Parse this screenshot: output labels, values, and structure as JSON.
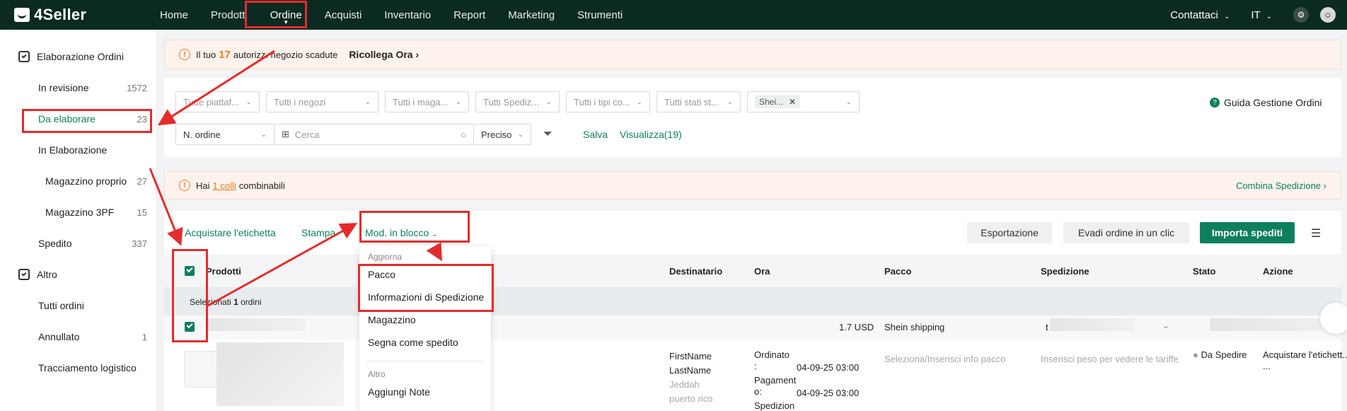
{
  "app": {
    "logo_text": "4Seller"
  },
  "nav": {
    "items": [
      {
        "label": "Home"
      },
      {
        "label": "Prodotti"
      },
      {
        "label": "Ordine"
      },
      {
        "label": "Acquisti"
      },
      {
        "label": "Inventario"
      },
      {
        "label": "Report"
      },
      {
        "label": "Marketing"
      },
      {
        "label": "Strumenti"
      }
    ],
    "contact": "Contattaci",
    "language": "IT"
  },
  "sidebar": {
    "section1": "Elaborazione Ordini",
    "items": [
      {
        "label": "In revisione",
        "count": "1572"
      },
      {
        "label": "Da elaborare",
        "count": "23"
      },
      {
        "label": "In Elaborazione",
        "count": ""
      },
      {
        "label": "Magazzino proprio",
        "count": "27"
      },
      {
        "label": "Magazzino 3PF",
        "count": "15"
      },
      {
        "label": "Spedito",
        "count": "337"
      }
    ],
    "section2": "Altro",
    "items2": [
      {
        "label": "Tutti ordini",
        "count": ""
      },
      {
        "label": "Annullato",
        "count": "1"
      },
      {
        "label": "Tracciamento logistico",
        "count": ""
      }
    ]
  },
  "alert1": {
    "prefix": "Il tuo",
    "number": "17",
    "suffix": "autorizz. negozio scadute",
    "action": "Ricollega Ora"
  },
  "filters": {
    "platform": "Tutte piattaf...",
    "shops": "Tutti i negozi",
    "warehouses": "Tutti i maga...",
    "shipping": "Tutti Spediz...",
    "types": "Tutti i tipi co...",
    "states": "Tutti stati st...",
    "tag": "Shei...",
    "guide": "Guida Gestione Ordini",
    "order_field": "N. ordine",
    "search_placeholder": "Cerca",
    "match": "Preciso",
    "save": "Salva",
    "view": "Visualizza(19)"
  },
  "alert2": {
    "prefix": "Hai",
    "link": "1 colli",
    "suffix": "combinabili",
    "action": "Combina Spedizione"
  },
  "toolbar": {
    "buy_label": "Acquistare l'etichetta",
    "print": "Stampa",
    "bulk_edit": "Mod. in blocco",
    "export": "Esportazione",
    "one_click": "Evadi ordine in un clic",
    "import_shipped": "Importa spediti"
  },
  "table": {
    "headers": {
      "products": "Prodotti",
      "recipient": "Destinatario",
      "time": "Ora",
      "package": "Pacco",
      "shipping": "Spedizione",
      "status": "Stato",
      "action": "Azione"
    },
    "selected_prefix": "Selezionati",
    "selected_count": "1",
    "selected_suffix": "ordini",
    "row": {
      "amount": "1.7 USD",
      "carrier": "Shein shipping",
      "ship_prefix": "t",
      "recipient_first": "FirstName",
      "recipient_last": "LastName",
      "city": "Jeddah",
      "region": "puerto rico",
      "ordered_label": "Ordinato",
      "ordered_colon": ":",
      "ordered_time": "04-09-25 03:00",
      "payment_label1": "Pagament",
      "payment_label2": "o:",
      "payment_time": "04-09-25 03:00",
      "ship_label": "Spedizion",
      "package_placeholder": "Seleziona/Inserisci info pacco",
      "weight_placeholder": "Inserisci peso per vedere le tariffe",
      "status": "Da Spedire",
      "action": "Acquistare l'etichett...",
      "more": "..."
    }
  },
  "dropdown": {
    "group1": "Aggiorna",
    "items1": [
      "Pacco",
      "Informazioni di Spedizione",
      "Magazzino",
      "Segna come spedito"
    ],
    "group2": "Altro",
    "items2": [
      "Aggiungi Note"
    ]
  },
  "colors": {
    "brand": "#0d7f5f",
    "nav_bg": "#0b2a22",
    "warning": "#f07a22",
    "annotation": "#e52b2b"
  }
}
